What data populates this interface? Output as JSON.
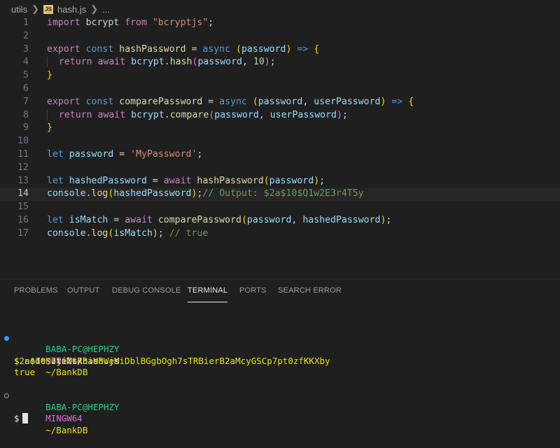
{
  "breadcrumb": {
    "folder": "utils",
    "file_icon": "JS",
    "file": "hash.js",
    "more": "..."
  },
  "editor": {
    "active_line": 14,
    "lines": [
      {
        "n": "1",
        "tokens": [
          [
            "kw",
            "import"
          ],
          [
            "pl",
            " bcrypt "
          ],
          [
            "kw",
            "from"
          ],
          [
            "pl",
            " "
          ],
          [
            "str",
            "\"bcryptjs\""
          ],
          [
            "pl",
            ";"
          ]
        ]
      },
      {
        "n": "2",
        "tokens": []
      },
      {
        "n": "3",
        "tokens": [
          [
            "kw",
            "export"
          ],
          [
            "pl",
            " "
          ],
          [
            "dk",
            "const"
          ],
          [
            "pl",
            " "
          ],
          [
            "fn",
            "hashPassword"
          ],
          [
            "pl",
            " = "
          ],
          [
            "dk",
            "async"
          ],
          [
            "pl",
            " "
          ],
          [
            "p1",
            "("
          ],
          [
            "var",
            "password"
          ],
          [
            "p1",
            ")"
          ],
          [
            "pl",
            " "
          ],
          [
            "dk",
            "=>"
          ],
          [
            "pl",
            " "
          ],
          [
            "p1",
            "{"
          ]
        ]
      },
      {
        "n": "4",
        "guide": true,
        "tokens": [
          [
            "kw",
            "return"
          ],
          [
            "pl",
            " "
          ],
          [
            "kw",
            "await"
          ],
          [
            "pl",
            " "
          ],
          [
            "var",
            "bcrypt"
          ],
          [
            "pl",
            "."
          ],
          [
            "fn",
            "hash"
          ],
          [
            "p2",
            "("
          ],
          [
            "var",
            "password"
          ],
          [
            "pl",
            ", "
          ],
          [
            "num",
            "10"
          ],
          [
            "p2",
            ")"
          ],
          [
            "pl",
            ";"
          ]
        ]
      },
      {
        "n": "5",
        "tokens": [
          [
            "p1",
            "}"
          ]
        ]
      },
      {
        "n": "6",
        "tokens": []
      },
      {
        "n": "7",
        "tokens": [
          [
            "kw",
            "export"
          ],
          [
            "pl",
            " "
          ],
          [
            "dk",
            "const"
          ],
          [
            "pl",
            " "
          ],
          [
            "fn",
            "comparePassword"
          ],
          [
            "pl",
            " = "
          ],
          [
            "dk",
            "async"
          ],
          [
            "pl",
            " "
          ],
          [
            "p1",
            "("
          ],
          [
            "var",
            "password"
          ],
          [
            "pl",
            ", "
          ],
          [
            "var",
            "userPassword"
          ],
          [
            "p1",
            ")"
          ],
          [
            "pl",
            " "
          ],
          [
            "dk",
            "=>"
          ],
          [
            "pl",
            " "
          ],
          [
            "p1",
            "{"
          ]
        ]
      },
      {
        "n": "8",
        "guide": true,
        "tokens": [
          [
            "kw",
            "return"
          ],
          [
            "pl",
            " "
          ],
          [
            "kw",
            "await"
          ],
          [
            "pl",
            " "
          ],
          [
            "var",
            "bcrypt"
          ],
          [
            "pl",
            "."
          ],
          [
            "fn",
            "compare"
          ],
          [
            "p2",
            "("
          ],
          [
            "var",
            "password"
          ],
          [
            "pl",
            ", "
          ],
          [
            "var",
            "userPassword"
          ],
          [
            "p2",
            ")"
          ],
          [
            "pl",
            ";"
          ]
        ]
      },
      {
        "n": "9",
        "tokens": [
          [
            "p1",
            "}"
          ]
        ]
      },
      {
        "n": "10",
        "tokens": []
      },
      {
        "n": "11",
        "tokens": [
          [
            "dk",
            "let"
          ],
          [
            "pl",
            " "
          ],
          [
            "var",
            "password"
          ],
          [
            "pl",
            " = "
          ],
          [
            "str",
            "'MyPassword'"
          ],
          [
            "pl",
            ";"
          ]
        ]
      },
      {
        "n": "12",
        "tokens": []
      },
      {
        "n": "13",
        "tokens": [
          [
            "dk",
            "let"
          ],
          [
            "pl",
            " "
          ],
          [
            "var",
            "hashedPassword"
          ],
          [
            "pl",
            " = "
          ],
          [
            "kw",
            "await"
          ],
          [
            "pl",
            " "
          ],
          [
            "fn",
            "hashPassword"
          ],
          [
            "p1",
            "("
          ],
          [
            "var",
            "password"
          ],
          [
            "p1",
            ")"
          ],
          [
            "pl",
            ";"
          ]
        ]
      },
      {
        "n": "14",
        "tokens": [
          [
            "var",
            "console"
          ],
          [
            "pl",
            "."
          ],
          [
            "fn",
            "log"
          ],
          [
            "p1",
            "("
          ],
          [
            "var",
            "hashedPassword"
          ],
          [
            "p1",
            ")"
          ],
          [
            "pl",
            ";"
          ],
          [
            "cm",
            "// Output: $2a$10$Q1w2E3r4T5y"
          ]
        ]
      },
      {
        "n": "15",
        "tokens": []
      },
      {
        "n": "16",
        "tokens": [
          [
            "dk",
            "let"
          ],
          [
            "pl",
            " "
          ],
          [
            "var",
            "isMatch"
          ],
          [
            "pl",
            " = "
          ],
          [
            "kw",
            "await"
          ],
          [
            "pl",
            " "
          ],
          [
            "fn",
            "comparePassword"
          ],
          [
            "p1",
            "("
          ],
          [
            "var",
            "password"
          ],
          [
            "pl",
            ", "
          ],
          [
            "var",
            "hashedPassword"
          ],
          [
            "p1",
            ")"
          ],
          [
            "pl",
            ";"
          ]
        ]
      },
      {
        "n": "17",
        "tokens": [
          [
            "var",
            "console"
          ],
          [
            "pl",
            "."
          ],
          [
            "fn",
            "log"
          ],
          [
            "p1",
            "("
          ],
          [
            "var",
            "isMatch"
          ],
          [
            "p1",
            ")"
          ],
          [
            "pl",
            "; "
          ],
          [
            "cm",
            "// true"
          ]
        ]
      }
    ]
  },
  "panel": {
    "tabs": [
      {
        "label": "PROBLEMS",
        "active": false
      },
      {
        "label": "OUTPUT",
        "active": false
      },
      {
        "label": "DEBUG CONSOLE",
        "active": false
      },
      {
        "label": "TERMINAL",
        "active": true
      },
      {
        "label": "PORTS",
        "active": false
      },
      {
        "label": "SEARCH ERROR",
        "active": false
      }
    ]
  },
  "terminal": {
    "prompt1": {
      "user": "BABA-PC@HEPHZY",
      "shell": "MINGW64",
      "path": "~/BankDB"
    },
    "command": "$ node utils/hash.js",
    "output_hash": "$2a$10$7jeMtR3iH8WeMiDblBGgbOgh7sTRBierB2aMcyGSCp7pt0zfKKXby",
    "output_bool": "true",
    "prompt2": {
      "user": "BABA-PC@HEPHZY",
      "shell": "MINGW64",
      "path": "~/BankDB"
    },
    "cursor_prompt": "$"
  },
  "colors": {
    "background": "#1f1f1f",
    "keyword": "#c586c0",
    "declaration": "#569cd6",
    "function": "#dcdcaa",
    "variable": "#9cdcfe",
    "string": "#ce9178",
    "comment": "#6a9955",
    "terminal_user": "#23d18b",
    "terminal_shell": "#d670d6",
    "terminal_path": "#e5e510"
  }
}
